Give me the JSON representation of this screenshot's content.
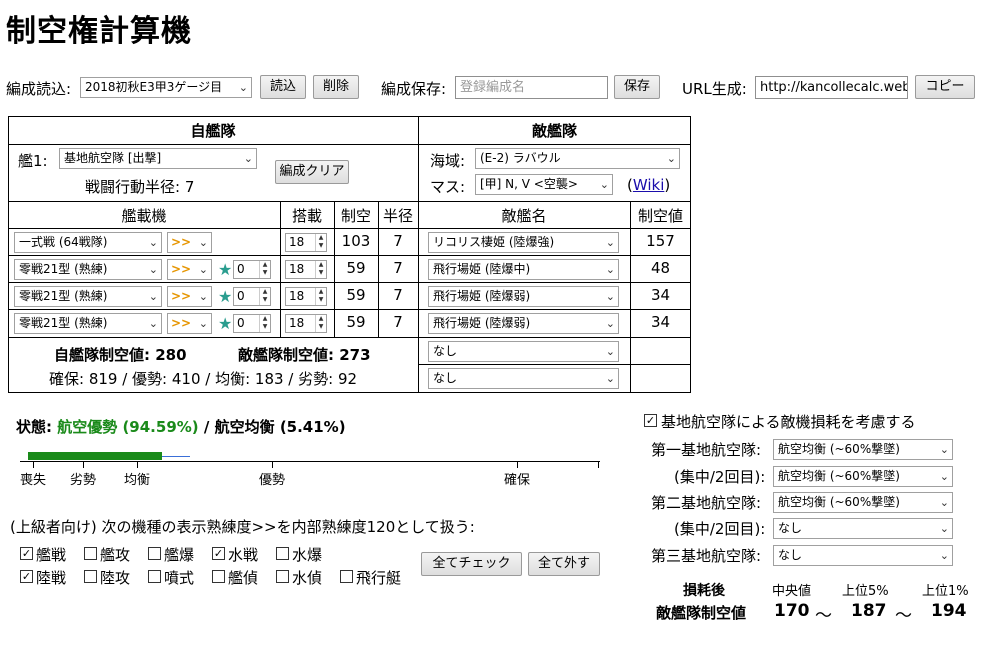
{
  "title": "制空権計算機",
  "toolbar": {
    "load_label": "編成読込:",
    "load_select": "2018初秋E3甲3ゲージ目",
    "load_button": "読込",
    "delete_button": "削除",
    "save_label": "編成保存:",
    "save_placeholder": "登録編成名",
    "save_button": "保存",
    "url_label": "URL生成:",
    "url_value": "http://kancollecalc.web.fc",
    "copy_button": "コピー"
  },
  "own": {
    "header": "自艦隊",
    "ship_label": "艦1:",
    "ship_select": "基地航空隊 [出撃]",
    "radius_text": "戦闘行動半径: 7",
    "clear_button": "編成クリア",
    "col_plane": "艦載機",
    "col_slot": "搭載",
    "col_air": "制空",
    "col_radius": "半径",
    "rows": [
      {
        "plane": "一式戦 (64戦隊)",
        "prof": ">>",
        "star": false,
        "improve": "",
        "slot": "18",
        "air": "103",
        "radius": "7"
      },
      {
        "plane": "零戦21型 (熟練)",
        "prof": ">>",
        "star": true,
        "improve": "0",
        "slot": "18",
        "air": "59",
        "radius": "7"
      },
      {
        "plane": "零戦21型 (熟練)",
        "prof": ">>",
        "star": true,
        "improve": "0",
        "slot": "18",
        "air": "59",
        "radius": "7"
      },
      {
        "plane": "零戦21型 (熟練)",
        "prof": ">>",
        "star": true,
        "improve": "0",
        "slot": "18",
        "air": "59",
        "radius": "7"
      }
    ],
    "own_air_label": "自艦隊制空値: 280",
    "enemy_air_label": "敵艦隊制空値: 273",
    "thresholds": "確保: 819 / 優勢: 410 / 均衡: 183 / 劣勢: 92"
  },
  "enemy": {
    "header": "敵艦隊",
    "area_label": "海域:",
    "area_select": "(E-2) ラバウル",
    "cell_label": "マス:",
    "cell_select": "[甲] N, V <空襲>",
    "wiki_link": "Wiki",
    "col_name": "敵艦名",
    "col_air": "制空値",
    "rows": [
      {
        "name": "リコリス棲姫 (陸爆強)",
        "air": "157"
      },
      {
        "name": "飛行場姫 (陸爆中)",
        "air": "48"
      },
      {
        "name": "飛行場姫 (陸爆弱)",
        "air": "34"
      },
      {
        "name": "飛行場姫 (陸爆弱)",
        "air": "34"
      },
      {
        "name": "なし",
        "air": ""
      },
      {
        "name": "なし",
        "air": ""
      }
    ]
  },
  "status": {
    "label": "状態:",
    "primary": "航空優勢 (94.59%)",
    "sep": " / ",
    "secondary": "航空均衡 (5.41%)",
    "bar_fill_fraction": 0.477,
    "ticks": [
      "喪失",
      "劣勢",
      "均衡",
      "優勢",
      "確保"
    ]
  },
  "advanced": {
    "text": "(上級者向け) 次の機種の表示熟練度>>を内部熟練度120として扱う:",
    "checks": [
      {
        "label": "艦戦",
        "checked": true
      },
      {
        "label": "艦攻",
        "checked": false
      },
      {
        "label": "艦爆",
        "checked": false
      },
      {
        "label": "水戦",
        "checked": true
      },
      {
        "label": "水爆",
        "checked": false
      },
      {
        "label": "陸戦",
        "checked": true
      },
      {
        "label": "陸攻",
        "checked": false
      },
      {
        "label": "噴式",
        "checked": false
      },
      {
        "label": "艦偵",
        "checked": false
      },
      {
        "label": "水偵",
        "checked": false
      },
      {
        "label": "飛行艇",
        "checked": false
      }
    ],
    "check_all": "全てチェック",
    "uncheck_all": "全て外す"
  },
  "base": {
    "consider_label": "基地航空隊による敵機損耗を考慮する",
    "consider_checked": true,
    "rows": [
      {
        "label": "第一基地航空隊:",
        "value": "航空均衡 (~60%撃墜)"
      },
      {
        "label": "(集中/2回目):",
        "value": "航空均衡 (~60%撃墜)"
      },
      {
        "label": "第二基地航空隊:",
        "value": "航空均衡 (~60%撃墜)"
      },
      {
        "label": "(集中/2回目):",
        "value": "なし"
      },
      {
        "label": "第三基地航空隊:",
        "value": "なし"
      }
    ],
    "result_title1": "損耗後",
    "result_title2": "敵艦隊制空値",
    "col_median": "中央値",
    "col_top5": "上位5%",
    "col_top1": "上位1%",
    "median": "170",
    "top5": "187",
    "top1": "194",
    "tilde": "〜"
  }
}
